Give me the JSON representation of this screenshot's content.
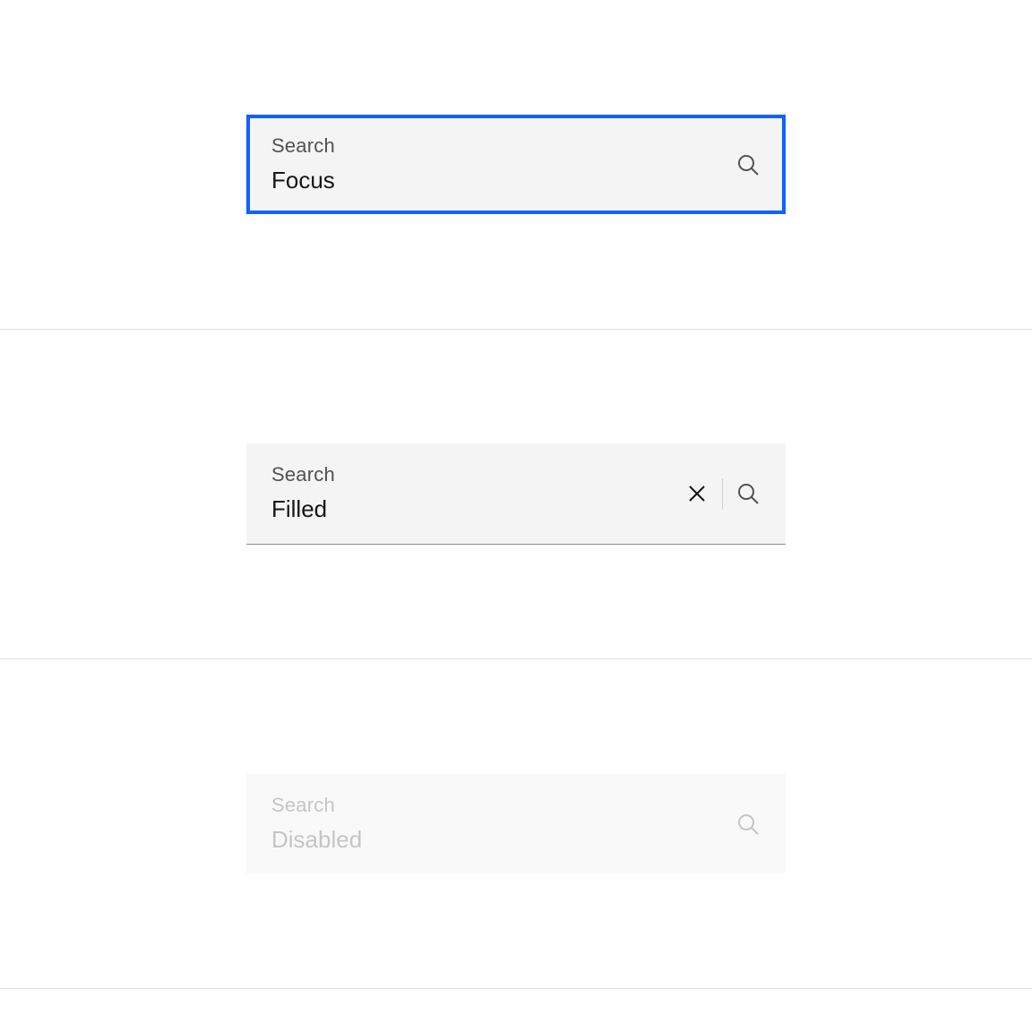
{
  "focus": {
    "label": "Search",
    "value": "Focus"
  },
  "filled": {
    "label": "Search",
    "value": "Filled"
  },
  "disabled": {
    "label": "Search",
    "value": "Disabled"
  }
}
